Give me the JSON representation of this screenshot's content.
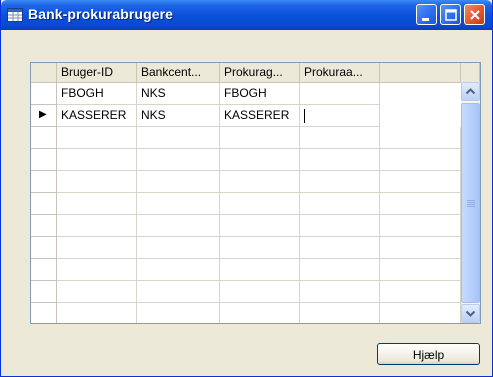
{
  "window": {
    "title": "Bank-prokurabrugere",
    "controls": [
      "minimize",
      "maximize",
      "close"
    ]
  },
  "grid": {
    "columns": [
      "Bruger-ID",
      "Bankcent...",
      "Prokurag...",
      "Prokuraa..."
    ],
    "rows": [
      {
        "cells": [
          "FBOGH",
          "NKS",
          "FBOGH",
          ""
        ],
        "current": false
      },
      {
        "cells": [
          "KASSERER",
          "NKS",
          "KASSERER",
          ""
        ],
        "current": true
      }
    ],
    "empty_rows": 9,
    "current_row_marker": "▶"
  },
  "buttons": {
    "help_label": "Hjælp"
  },
  "colors": {
    "titlebar": "#0b52dc",
    "window_bg": "#ece9d8",
    "grid_border": "#7f9db9"
  }
}
